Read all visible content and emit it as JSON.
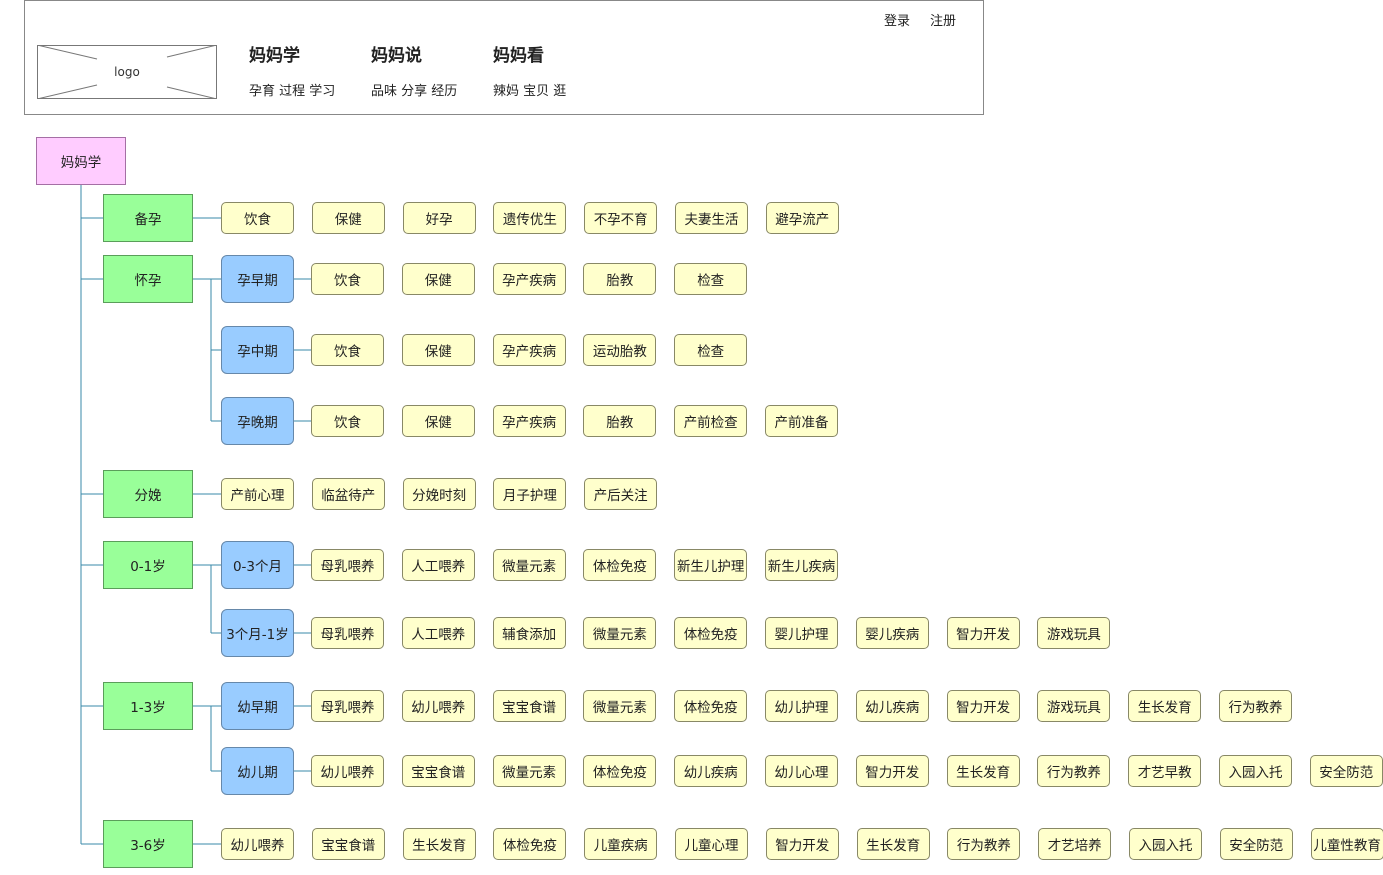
{
  "header": {
    "logo_label": "logo",
    "login_label": "登录",
    "register_label": "注册",
    "nav": [
      {
        "title": "妈妈学",
        "sub": "孕育 过程 学习"
      },
      {
        "title": "妈妈说",
        "sub": "品味 分享 经历"
      },
      {
        "title": "妈妈看",
        "sub": "辣妈 宝贝 逛"
      }
    ]
  },
  "tree": {
    "root": "妈妈学",
    "stages": [
      {
        "label": "备孕",
        "leaves": [
          "饮食",
          "保健",
          "好孕",
          "遗传优生",
          "不孕不育",
          "夫妻生活",
          "避孕流产"
        ]
      },
      {
        "label": "怀孕",
        "subs": [
          {
            "label": "孕早期",
            "leaves": [
              "饮食",
              "保健",
              "孕产疾病",
              "胎教",
              "检查"
            ]
          },
          {
            "label": "孕中期",
            "leaves": [
              "饮食",
              "保健",
              "孕产疾病",
              "运动胎教",
              "检查"
            ]
          },
          {
            "label": "孕晚期",
            "leaves": [
              "饮食",
              "保健",
              "孕产疾病",
              "胎教",
              "产前检查",
              "产前准备"
            ]
          }
        ]
      },
      {
        "label": "分娩",
        "leaves": [
          "产前心理",
          "临盆待产",
          "分娩时刻",
          "月子护理",
          "产后关注"
        ]
      },
      {
        "label": "0-1岁",
        "subs": [
          {
            "label": "0-3个月",
            "leaves": [
              "母乳喂养",
              "人工喂养",
              "微量元素",
              "体检免疫",
              "新生儿护理",
              "新生儿疾病"
            ]
          },
          {
            "label": "3个月-1岁",
            "leaves": [
              "母乳喂养",
              "人工喂养",
              "辅食添加",
              "微量元素",
              "体检免疫",
              "婴儿护理",
              "婴儿疾病",
              "智力开发",
              "游戏玩具"
            ]
          }
        ]
      },
      {
        "label": "1-3岁",
        "subs": [
          {
            "label": "幼早期",
            "leaves": [
              "母乳喂养",
              "幼儿喂养",
              "宝宝食谱",
              "微量元素",
              "体检免疫",
              "幼儿护理",
              "幼儿疾病",
              "智力开发",
              "游戏玩具",
              "生长发育",
              "行为教养"
            ]
          },
          {
            "label": "幼儿期",
            "leaves": [
              "幼儿喂养",
              "宝宝食谱",
              "微量元素",
              "体检免疫",
              "幼儿疾病",
              "幼儿心理",
              "智力开发",
              "生长发育",
              "行为教养",
              "才艺早教",
              "入园入托",
              "安全防范"
            ]
          }
        ]
      },
      {
        "label": "3-6岁",
        "leaves": [
          "幼儿喂养",
          "宝宝食谱",
          "生长发育",
          "体检免疫",
          "儿童疾病",
          "儿童心理",
          "智力开发",
          "生长发育",
          "行为教养",
          "才艺培养",
          "入园入托",
          "安全防范",
          "儿童性教育"
        ]
      }
    ]
  },
  "colors": {
    "root": "#ffccff",
    "stage": "#99ff99",
    "sub": "#99ccff",
    "leaf": "#ffffcc",
    "connector": "#3a8aaa"
  }
}
